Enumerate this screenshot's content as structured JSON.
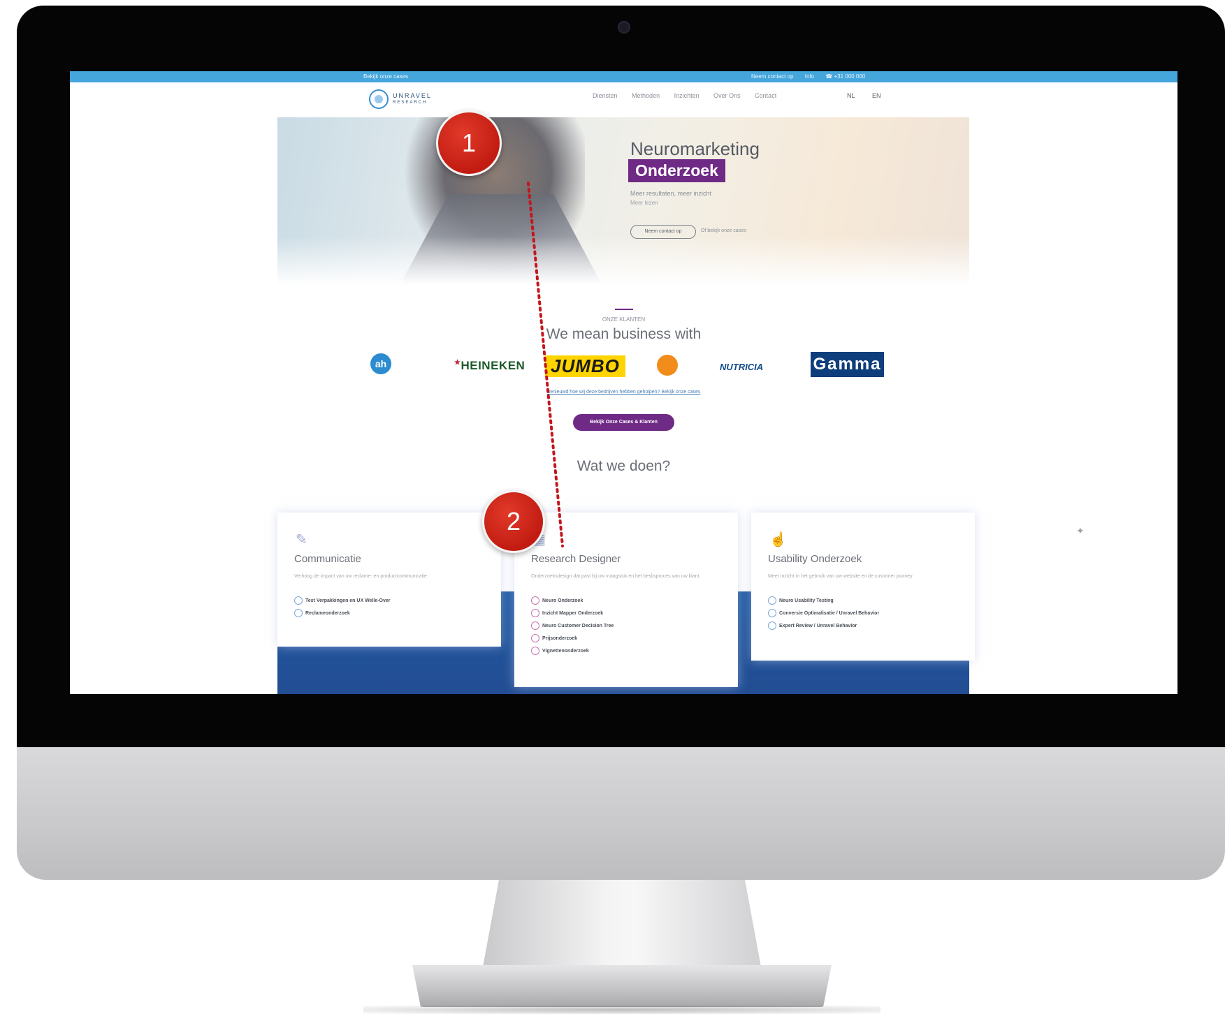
{
  "site": {
    "topbar": {
      "left_text": "Bekijk onze cases",
      "right_items": [
        "Neem contact op",
        "Info",
        "☎ +31 000 000"
      ]
    },
    "logo": {
      "name": "UNRAVEL",
      "sub": "RESEARCH"
    },
    "nav": [
      "Diensten",
      "Methoden",
      "Inzichten",
      "Over Ons",
      "Contact"
    ],
    "languages": [
      "NL",
      "EN"
    ],
    "hero": {
      "title": "Neuromarketing",
      "badge": "Onderzoek",
      "subtitle": "Meer resultaten, meer inzicht",
      "subtitle2": "Meer lezen",
      "button": "Neem contact op",
      "link": "Of bekijk onze cases"
    },
    "clients": {
      "label": "ONZE KLANTEN",
      "heading": "We mean business with",
      "logos": [
        "ah",
        "HEINEKEN",
        "JUMBO",
        "orange",
        "NUTRICIA",
        "Gamma"
      ],
      "link": "Benieuwd hoe wij deze bedrijven hebben geholpen? Bekijk onze cases",
      "cases_button": "Bekijk Onze Cases & Klanten"
    },
    "services": {
      "heading": "Wat we doen?",
      "cards": [
        {
          "title": "Communicatie",
          "description": "Verhoog de impact van uw reclame- en productcommunicatie.",
          "items": [
            "Test Verpakkingen en UX Welle-Over",
            "Reclameonderzoek"
          ]
        },
        {
          "title": "Research Designer",
          "description": "Onderzoeksdesign dat past bij uw vraagstuk en het beslisproces van uw klant.",
          "items": [
            "Neuro Onderzoek",
            "Inzicht Mapper Onderzoek",
            "Neuro Customer Decision Tree",
            "Prijsonderzoek",
            "Vignettenonderzoek"
          ]
        },
        {
          "title": "Usability Onderzoek",
          "description": "Meer inzicht in het gebruik van uw website en de customer journey.",
          "items": [
            "Neuro Usability Testing",
            "Conversie Optimalisatie / Unravel Behavior",
            "Expert Review / Unravel Behavior"
          ]
        }
      ]
    }
  },
  "annotations": {
    "markers": [
      "1",
      "2"
    ],
    "connector_color": "#c4161c"
  },
  "colors": {
    "brand_purple": "#6f2a86",
    "topbar_blue": "#45a6dc",
    "services_blue": "#1f5aa4"
  }
}
